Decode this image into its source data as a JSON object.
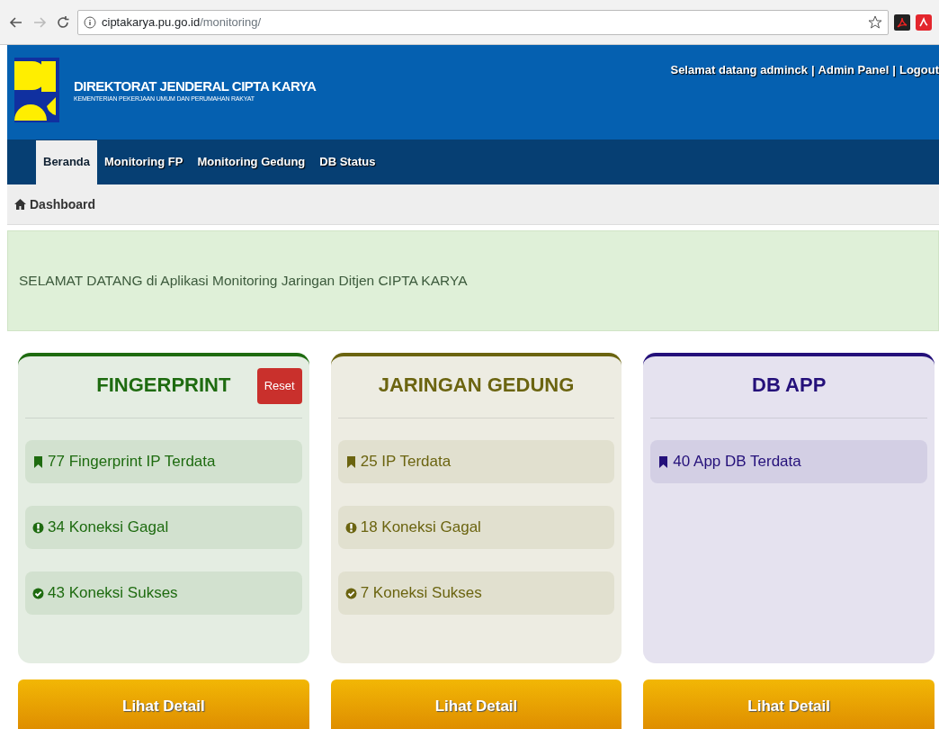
{
  "browser": {
    "url_host": "ciptakarya.pu.go.id",
    "url_path": "/monitoring/"
  },
  "header": {
    "title": "DIREKTORAT JENDERAL CIPTA KARYA",
    "subtitle": "KEMENTERIAN PEKERJAAN UMUM DAN PERUMAHAN RAKYAT",
    "greeting": "Selamat datang adminck",
    "links": [
      "Admin Panel",
      "Logout"
    ],
    "separator": "|"
  },
  "nav": [
    {
      "label": "Beranda",
      "selected": true
    },
    {
      "label": "Monitoring FP",
      "selected": false
    },
    {
      "label": "Monitoring Gedung",
      "selected": false
    },
    {
      "label": "DB Status",
      "selected": false
    }
  ],
  "breadcrumb": "Dashboard",
  "welcome": "SELAMAT DATANG di Aplikasi Monitoring Jaringan Ditjen CIPTA KARYA",
  "cards": [
    {
      "title": "FINGERPRINT",
      "color": "#1e6b10",
      "reset_button": "Reset",
      "items": [
        {
          "kind": "registered",
          "text": "77 Fingerprint IP Terdata"
        },
        {
          "kind": "failed",
          "text": "34 Koneksi Gagal"
        },
        {
          "kind": "success",
          "text": "43 Koneksi Sukses"
        }
      ],
      "button": "Lihat Detail"
    },
    {
      "title": "JARINGAN GEDUNG",
      "color": "#6b6410",
      "items": [
        {
          "kind": "registered",
          "text": "25 IP Terdata"
        },
        {
          "kind": "failed",
          "text": "18 Koneksi Gagal"
        },
        {
          "kind": "success",
          "text": "7 Koneksi Sukses"
        }
      ],
      "button": "Lihat Detail"
    },
    {
      "title": "DB APP",
      "color": "#24107a",
      "items": [
        {
          "kind": "registered",
          "text": "40 App DB Terdata"
        }
      ],
      "button": "Lihat Detail"
    }
  ]
}
